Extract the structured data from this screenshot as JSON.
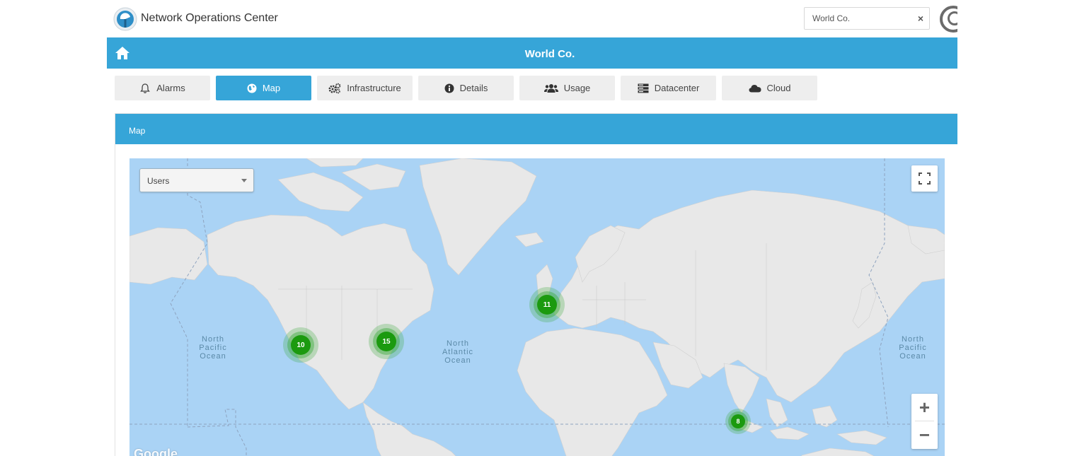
{
  "header": {
    "app_title": "Network Operations Center",
    "search_value": "World Co.",
    "clear_label": "×"
  },
  "banner": {
    "title": "World Co."
  },
  "tabs": [
    {
      "label": "Alarms",
      "icon": "bell-icon",
      "active": false
    },
    {
      "label": "Map",
      "icon": "globe-icon",
      "active": true
    },
    {
      "label": "Infrastructure",
      "icon": "gears-icon",
      "active": false
    },
    {
      "label": "Details",
      "icon": "info-icon",
      "active": false
    },
    {
      "label": "Usage",
      "icon": "users-icon",
      "active": false
    },
    {
      "label": "Datacenter",
      "icon": "server-icon",
      "active": false
    },
    {
      "label": "Cloud",
      "icon": "cloud-icon",
      "active": false
    }
  ],
  "panel": {
    "title": "Map"
  },
  "map": {
    "layer_select": "Users",
    "zoom_in": "+",
    "zoom_out": "−",
    "attribution": "Google",
    "ocean_labels": {
      "north_pacific_west": [
        "North",
        "Pacific",
        "Ocean"
      ],
      "north_atlantic": [
        "North",
        "Atlantic",
        "Ocean"
      ],
      "north_pacific_east": [
        "North",
        "Pacific",
        "Ocean"
      ]
    },
    "clusters": [
      {
        "count": "10",
        "region": "US West"
      },
      {
        "count": "15",
        "region": "US East"
      },
      {
        "count": "11",
        "region": "Western Europe"
      },
      {
        "count": "8",
        "region": "Indonesia"
      }
    ]
  },
  "colors": {
    "accent": "#36a5d8",
    "tab_bg": "#eeeeee",
    "ocean": "#aad3f5",
    "land": "#e8e8e8",
    "cluster": "#1b9a0f"
  }
}
